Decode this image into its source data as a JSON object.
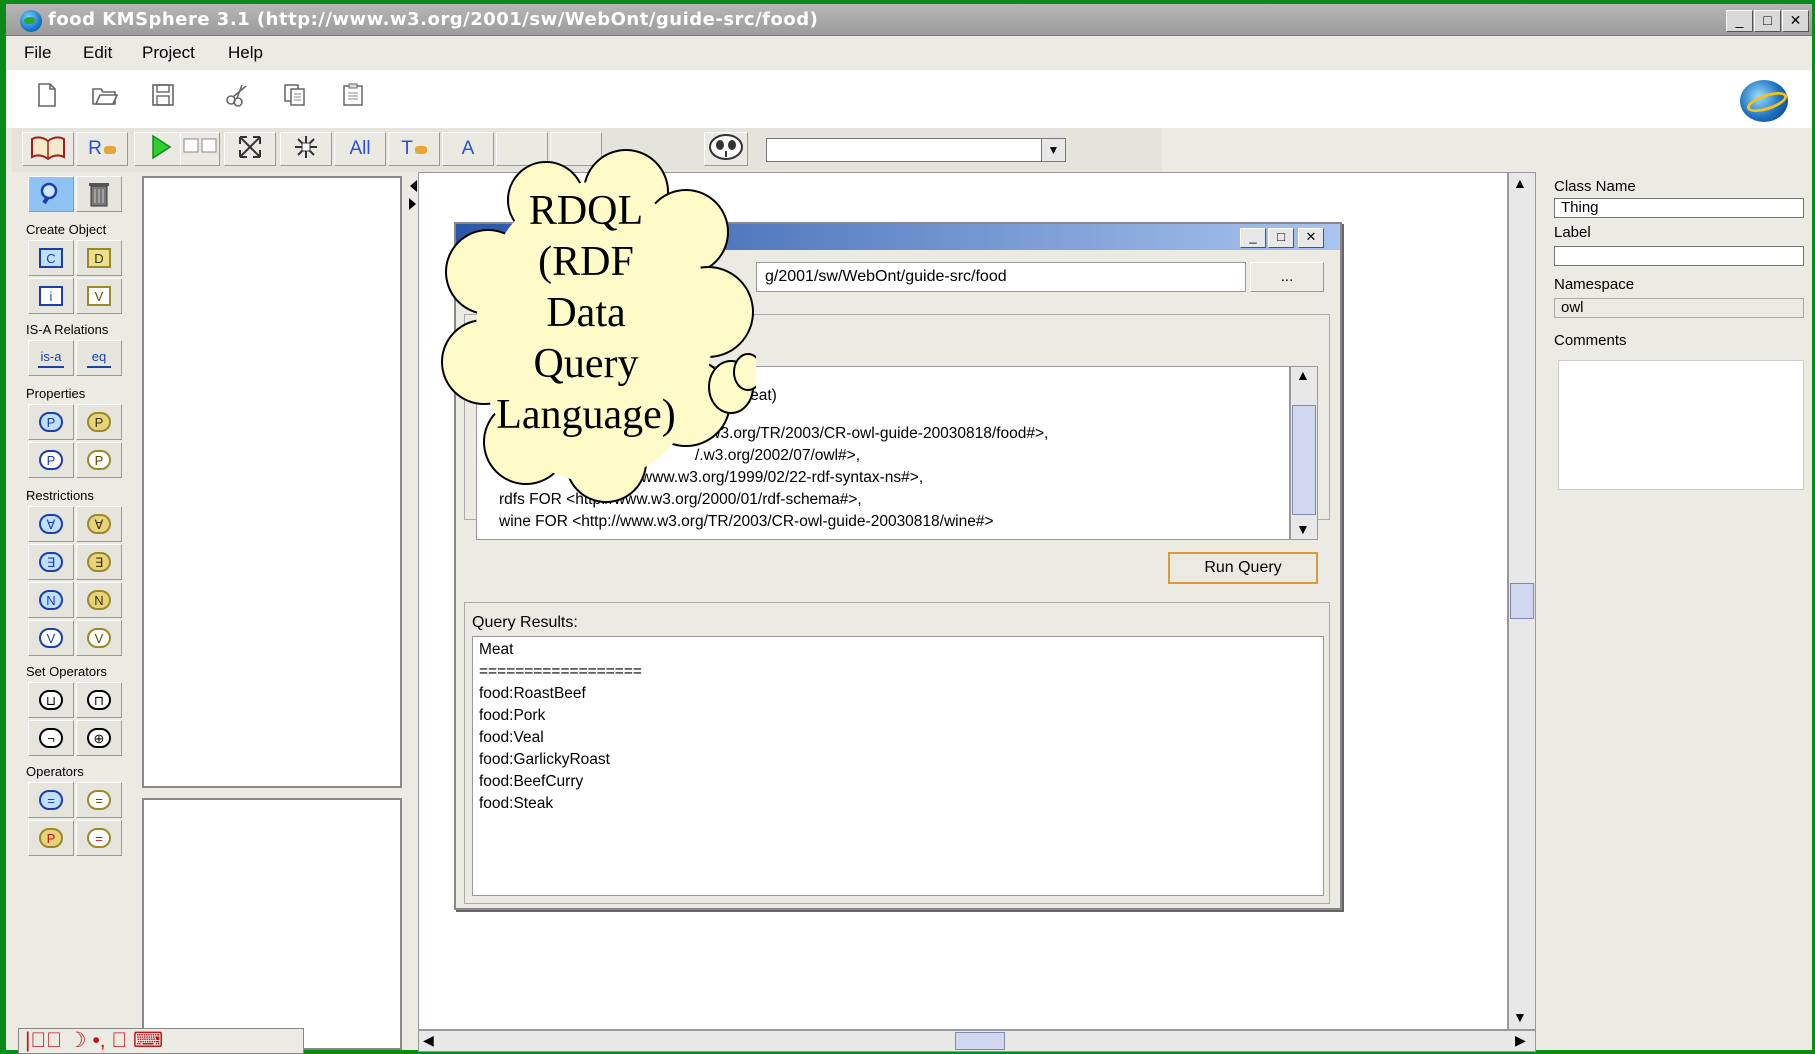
{
  "window": {
    "title": "food  KMSphere 3.1     (http://www.w3.org/2001/sw/WebOnt/guide-src/food)",
    "minimize": "_",
    "maximize": "□",
    "close": "✕"
  },
  "menu": [
    "File",
    "Edit",
    "Project",
    "Help"
  ],
  "toolbar2": {
    "r_btn": "R",
    "all_btn": "All",
    "t_btn": "T",
    "a_btn": "A",
    "combo_value": ""
  },
  "palette": {
    "create_object": "Create Object",
    "isa_relations": "IS-A Relations",
    "properties": "Properties",
    "restrictions": "Restrictions",
    "set_operators": "Set Operators",
    "operators": "Operators",
    "btn_c": "C",
    "btn_d": "D",
    "btn_i": "i",
    "btn_v": "V",
    "btn_isa": "is-a",
    "btn_eq": "eq",
    "btn_p": "P",
    "btn_pd": "P",
    "btn_all": "∀",
    "btn_all_d": "∀",
    "btn_exists": "∃",
    "btn_exists_d": "∃",
    "btn_n": "N",
    "btn_n_d": "N",
    "btn_val": "V",
    "btn_val_d": "V",
    "btn_union": "⊔",
    "btn_intersect": "⊓",
    "btn_not": "¬",
    "btn_oneof": "⊕",
    "btn_eq_op": "=",
    "btn_neq_op": "="
  },
  "props": {
    "class_name_label": "Class Name",
    "class_name_value": "Thing",
    "label_label": "Label",
    "label_value": "",
    "namespace_label": "Namespace",
    "namespace_value": "owl",
    "comments_label": "Comments"
  },
  "dialog": {
    "url_value": "g/2001/sw/WebOnt/guide-src/food",
    "browse_label": "...",
    "query_lines": [
      "ood:Meat)",
      ".w3.org/TR/2003/CR-owl-guide-20030818/food#>,",
      "/.w3.org/2002/07/owl#>,",
      "www.w3.org/1999/02/22-rdf-syntax-ns#>,",
      "rdfs FOR <http://www.w3.org/2000/01/rdf-schema#>,",
      "wine FOR <http://www.w3.org/TR/2003/CR-owl-guide-20030818/wine#>"
    ],
    "run_query_label": "Run Query",
    "results_label": "Query Results:",
    "results_lines": [
      "Meat",
      "==================",
      "food:RoastBeef",
      "food:Pork",
      "food:Veal",
      "food:GarlickyRoast",
      "food:BeefCurry",
      "food:Steak"
    ]
  },
  "callout": {
    "lines": [
      "RDQL",
      "(RDF",
      "Data",
      "Query",
      "Language)"
    ]
  },
  "ime": {
    "text": "|𩙊英 ☽ •, 大 ⌨"
  },
  "colors": {
    "desktop_green": "#0a8a16",
    "cloud_fill": "#fffbc9",
    "run_query_border": "#d89a3a",
    "dialog_title_start": "#2a57a8"
  }
}
